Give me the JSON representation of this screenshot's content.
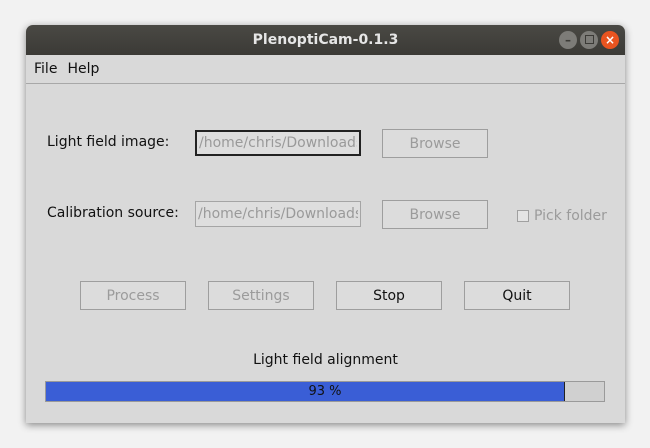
{
  "window": {
    "title": "PlenoptiCam-0.1.3",
    "controls": {
      "minimize": "minimize-icon",
      "maximize": "maximize-icon",
      "close": "close-icon"
    }
  },
  "menu": {
    "file": "File",
    "help": "Help"
  },
  "form": {
    "lf_label": "Light field image:",
    "lf_path": "/home/chris/Downloads/L",
    "lf_browse": "Browse",
    "cal_label": "Calibration source:",
    "cal_path": "/home/chris/Downloads/L",
    "cal_browse": "Browse",
    "pick_folder_label": "Pick folder",
    "pick_folder_checked": false
  },
  "actions": {
    "process": "Process",
    "settings": "Settings",
    "stop": "Stop",
    "quit": "Quit"
  },
  "status": {
    "label": "Light field alignment",
    "progress_percent": 93,
    "progress_text": "93 %"
  },
  "colors": {
    "progress_fill": "#3a5ed6",
    "close_button": "#e95420",
    "titlebar": "#3b3a36"
  }
}
